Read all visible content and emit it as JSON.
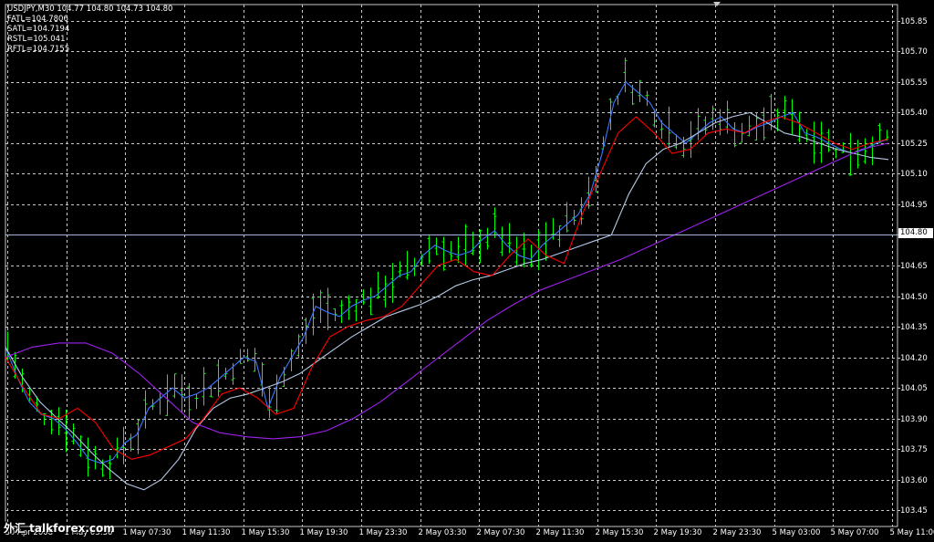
{
  "header": {
    "symbol_line": "USDJPY,M30  104.77 104.80 104.73 104.80",
    "indicators": [
      "FATL=104.7806",
      "SATL=104.7194",
      "RSTL=105.041",
      "RFTL=104.7155"
    ]
  },
  "current_price_label": "104.80",
  "watermark": "外汇  talkforex.com",
  "colors": {
    "background": "#000000",
    "grid": "#c8c8c8",
    "candle": "#00ff00",
    "fatl": "#3a78ff",
    "satl": "#b4c8e6",
    "rstl": "#a020f0",
    "rftl": "#ff0000",
    "price_line": "#a4b4d8"
  },
  "chart_data": {
    "type": "line",
    "title": "USDJPY,M30",
    "xlabel": "",
    "ylabel": "",
    "ylim": [
      103.37,
      105.93
    ],
    "grid": true,
    "price_scale": "right",
    "current_price": 104.8,
    "y_ticks": [
      "105.85",
      "105.70",
      "105.55",
      "105.40",
      "105.25",
      "105.10",
      "104.95",
      "104.80",
      "104.65",
      "104.50",
      "104.35",
      "104.20",
      "104.05",
      "103.90",
      "103.75",
      "103.60",
      "103.45"
    ],
    "x_ticks": [
      "30 Apr 2008",
      "1 May 03:30",
      "1 May 07:30",
      "1 May 11:30",
      "1 May 15:30",
      "1 May 19:30",
      "1 May 23:30",
      "2 May 03:30",
      "2 May 07:30",
      "2 May 11:30",
      "2 May 15:30",
      "2 May 19:30",
      "2 May 23:30",
      "5 May 03:00",
      "5 May 07:00",
      "5 May 11:00"
    ],
    "bars": {
      "count": 122,
      "series_style": "bars",
      "bar_ranges": [
        {
          "segment": "30 Apr late to 1 May 03:30",
          "low": 103.62,
          "high": 104.0
        },
        {
          "segment": "1 May 11:30 to 1 May 15:30",
          "low": 103.72,
          "high": 104.2
        },
        {
          "segment": "1 May 19:30 to 2 May 03:30",
          "low": 104.25,
          "high": 104.8
        },
        {
          "segment": "2 May 07:30 to 2 May 11:30",
          "low": 104.57,
          "high": 104.98
        },
        {
          "segment": "2 May 15:30",
          "low": 104.7,
          "high": 105.7
        },
        {
          "segment": "5 May",
          "low": 105.15,
          "high": 105.5
        }
      ]
    },
    "series": [
      {
        "name": "FATL",
        "values": [
          104.25,
          104.1,
          103.98,
          103.92,
          103.9,
          103.85,
          103.78,
          103.7,
          103.68,
          103.7,
          103.78,
          103.82,
          103.95,
          104.0,
          104.05,
          104.0,
          104.02,
          104.05,
          104.1,
          104.15,
          104.2,
          104.18,
          103.95,
          104.1,
          104.2,
          104.3,
          104.45,
          104.42,
          104.4,
          104.45,
          104.48,
          104.5,
          104.55,
          104.6,
          104.62,
          104.7,
          104.75,
          104.72,
          104.7,
          104.72,
          104.78,
          104.82,
          104.75,
          104.7,
          104.68,
          104.75,
          104.8,
          104.85,
          104.9,
          105.0,
          105.2,
          105.45,
          105.55,
          105.5,
          105.45,
          105.35,
          105.3,
          105.25,
          105.3,
          105.35,
          105.38,
          105.32,
          105.3,
          105.33,
          105.35,
          105.38,
          105.4,
          105.3,
          105.28,
          105.25,
          105.22,
          105.2,
          105.22,
          105.25,
          105.27
        ],
        "x_span": [
          "30 Apr 2008",
          "5 May 11:00"
        ]
      },
      {
        "name": "SATL",
        "values": [
          104.25,
          104.1,
          103.98,
          103.9,
          103.82,
          103.73,
          103.65,
          103.58,
          103.55,
          103.6,
          103.7,
          103.85,
          103.95,
          104.0,
          104.02,
          104.05,
          104.08,
          104.12,
          104.18,
          104.24,
          104.3,
          104.35,
          104.4,
          104.43,
          104.46,
          104.5,
          104.55,
          104.58,
          104.6,
          104.63,
          104.66,
          104.68,
          104.71,
          104.74,
          104.77,
          104.8,
          105.0,
          105.15,
          105.22,
          105.25,
          105.3,
          105.35,
          105.38,
          105.4,
          105.35,
          105.3,
          105.28,
          105.25,
          105.22,
          105.2,
          105.18,
          105.17
        ],
        "x_span": [
          "30 Apr 2008",
          "5 May 11:00"
        ]
      },
      {
        "name": "RSTL",
        "values": [
          104.2,
          104.25,
          104.27,
          104.27,
          104.22,
          104.12,
          104.0,
          103.88,
          103.83,
          103.81,
          103.8,
          103.81,
          103.84,
          103.9,
          103.98,
          104.08,
          104.18,
          104.28,
          104.38,
          104.46,
          104.53,
          104.58,
          104.63,
          104.68,
          104.74,
          104.8,
          104.86,
          104.92,
          104.98,
          105.04,
          105.1,
          105.16,
          105.22,
          105.25
        ],
        "x_span": [
          "30 Apr 2008",
          "5 May 11:00"
        ]
      },
      {
        "name": "RFTL",
        "values": [
          104.2,
          104.05,
          103.92,
          103.9,
          103.95,
          103.88,
          103.75,
          103.7,
          103.72,
          103.76,
          103.8,
          103.9,
          104.02,
          104.05,
          104.0,
          103.92,
          103.95,
          104.15,
          104.3,
          104.35,
          104.38,
          104.4,
          104.45,
          104.55,
          104.65,
          104.68,
          104.62,
          104.6,
          104.7,
          104.78,
          104.7,
          104.66,
          104.9,
          105.1,
          105.3,
          105.38,
          105.3,
          105.2,
          105.22,
          105.3,
          105.32,
          105.3,
          105.35,
          105.38,
          105.35,
          105.3,
          105.25,
          105.22,
          105.25,
          105.27
        ],
        "x_span": [
          "30 Apr 2008",
          "5 May 11:00"
        ]
      }
    ]
  }
}
